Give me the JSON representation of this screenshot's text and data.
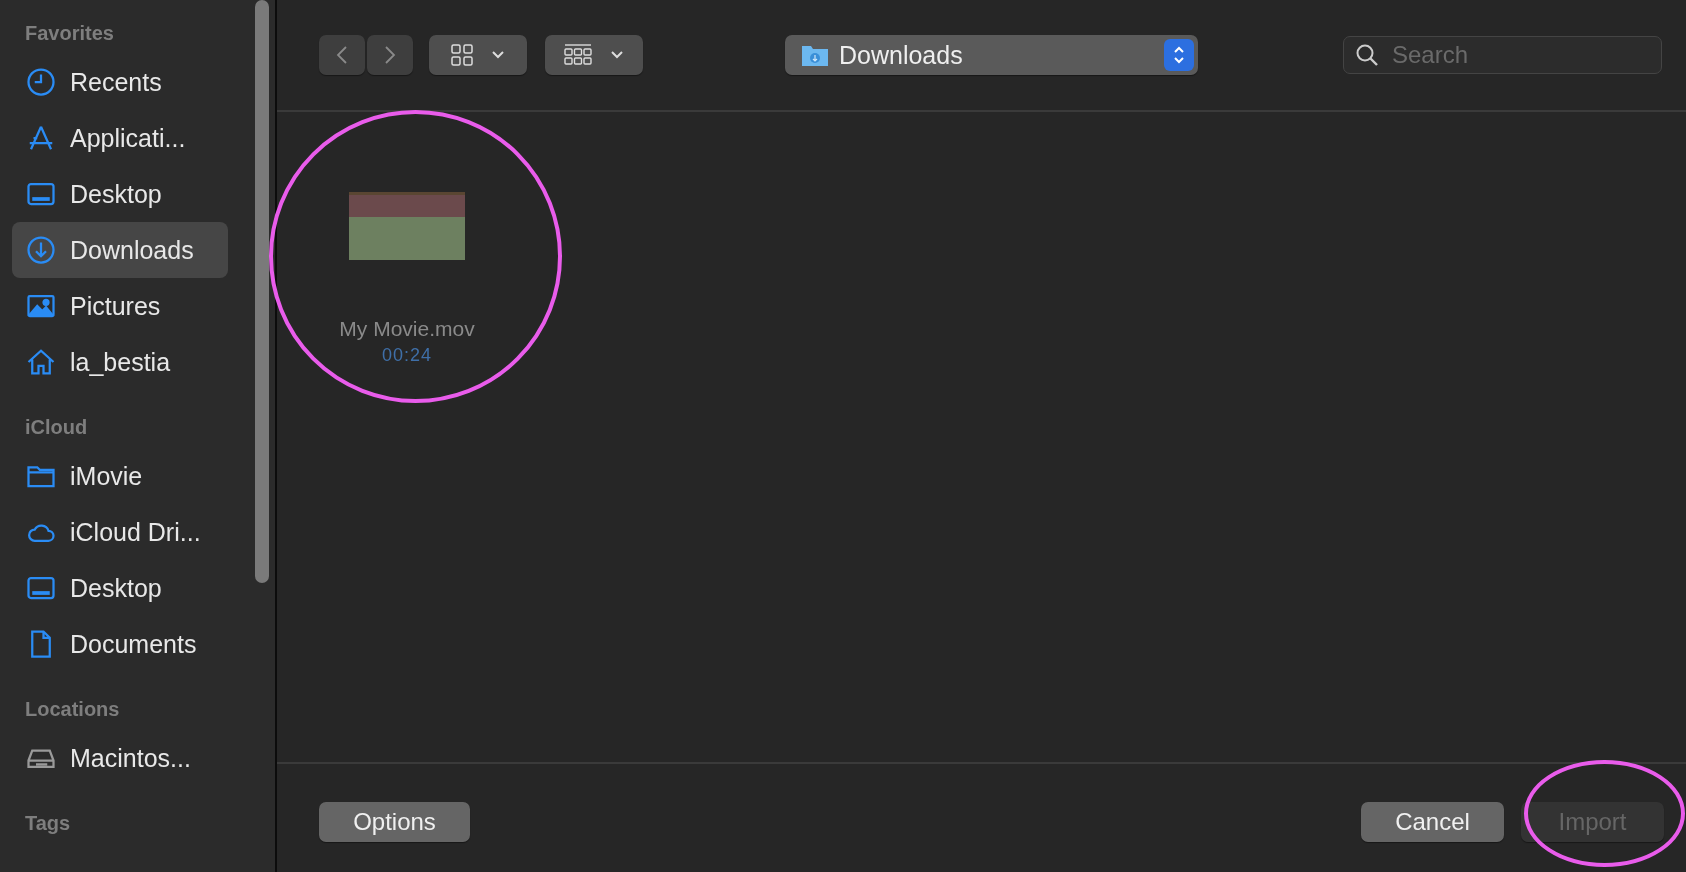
{
  "sidebar": {
    "sections": [
      {
        "title": "Favorites",
        "items": [
          {
            "kind": "clock",
            "label": "Recents",
            "selected": false
          },
          {
            "kind": "apps",
            "label": "Applicati...",
            "selected": false
          },
          {
            "kind": "display",
            "label": "Desktop",
            "selected": false
          },
          {
            "kind": "download",
            "label": "Downloads",
            "selected": true
          },
          {
            "kind": "photo",
            "label": "Pictures",
            "selected": false
          },
          {
            "kind": "home",
            "label": "la_bestia",
            "selected": false
          }
        ]
      },
      {
        "title": "iCloud",
        "items": [
          {
            "kind": "folder",
            "label": "iMovie",
            "selected": false
          },
          {
            "kind": "cloud",
            "label": "iCloud Dri...",
            "selected": false
          },
          {
            "kind": "display",
            "label": "Desktop",
            "selected": false
          },
          {
            "kind": "document",
            "label": "Documents",
            "selected": false
          }
        ]
      },
      {
        "title": "Locations",
        "items": [
          {
            "kind": "disk",
            "label": "Macintos...",
            "selected": false
          }
        ]
      },
      {
        "title": "Tags"
      }
    ]
  },
  "toolbar": {
    "location": "Downloads",
    "search": {
      "placeholder": "Search"
    }
  },
  "files": [
    {
      "name": "My Movie.mov",
      "duration": "00:24"
    }
  ],
  "buttons": [
    {
      "label": "Options",
      "disabled": false
    },
    {
      "label": "Cancel",
      "disabled": false
    },
    {
      "label": "Import",
      "disabled": true
    }
  ]
}
